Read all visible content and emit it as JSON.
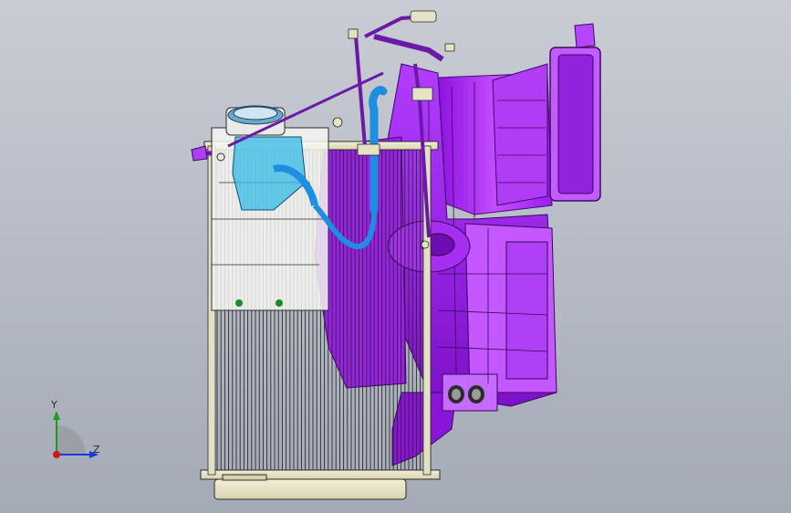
{
  "viewport": {
    "background_top": "#c9ccd3",
    "background_bottom": "#a4aab6"
  },
  "model": {
    "colors": {
      "housing": "#a020f0",
      "housing_light": "#c65bff",
      "hose_blue": "#1e8fe0",
      "hose_cyan": "#38c6e8",
      "frame": "#e8e4c8",
      "compressor": "#f4f4f4",
      "line": "#2b2b2b"
    }
  },
  "triad": {
    "y_label": "Y",
    "z_label": "Z",
    "y_color": "#1a9e1a",
    "z_color": "#1a3ad8",
    "origin_color": "#d01818"
  }
}
